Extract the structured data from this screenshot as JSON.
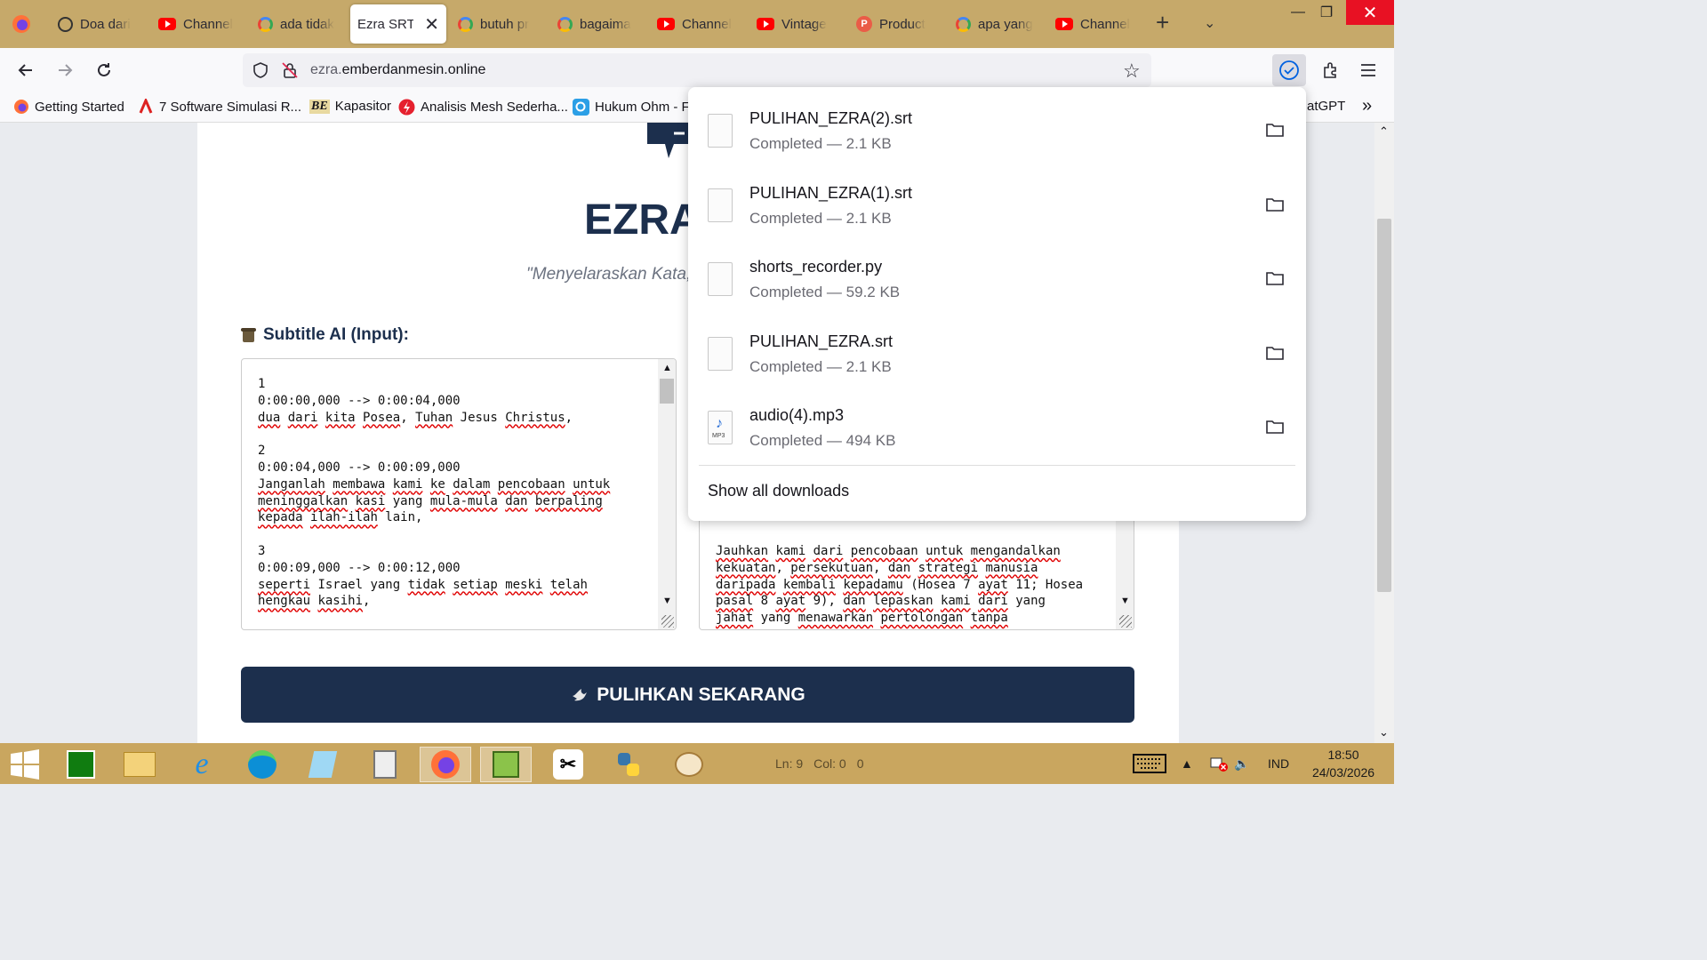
{
  "browser": {
    "tabs": [
      {
        "label": "Doa dari",
        "icon": "chatgpt-icon"
      },
      {
        "label": "Channel",
        "icon": "youtube-icon"
      },
      {
        "label": "ada tidak",
        "icon": "google-icon"
      },
      {
        "label": "Ezra SRT -",
        "icon": "none",
        "active": true
      },
      {
        "label": "butuh pr",
        "icon": "google-icon"
      },
      {
        "label": "bagaima",
        "icon": "google-icon"
      },
      {
        "label": "Channel",
        "icon": "youtube-icon"
      },
      {
        "label": "Vintage",
        "icon": "youtube-icon"
      },
      {
        "label": "Product",
        "icon": "product-hunt-icon"
      },
      {
        "label": "apa yang",
        "icon": "google-icon"
      },
      {
        "label": "Channel",
        "icon": "youtube-icon"
      }
    ],
    "url_host_prefix": "ezra.",
    "url_host_main": "emberdanmesin.online",
    "bookmarks": [
      {
        "label": "Getting Started"
      },
      {
        "label": "7 Software Simulasi R..."
      },
      {
        "label": "Kapasitor"
      },
      {
        "label": "Analisis Mesh Sederha..."
      },
      {
        "label": "Hukum Ohm - F"
      },
      {
        "label": "atGPT"
      }
    ]
  },
  "page": {
    "title": "EZRA",
    "tagline": "\"Menyelaraskan Kata,",
    "input_label": "Subtitle AI (Input):",
    "input_lines": [
      [
        {
          "t": "1"
        }
      ],
      [
        {
          "t": "0:00:00,000 --> 0:00:04,000"
        }
      ],
      [
        {
          "t": "dua",
          "s": 1
        },
        {
          "t": " "
        },
        {
          "t": "dari",
          "s": 1
        },
        {
          "t": " "
        },
        {
          "t": "kita",
          "s": 1
        },
        {
          "t": " "
        },
        {
          "t": "Posea",
          "s": 1
        },
        {
          "t": ", "
        },
        {
          "t": "Tuhan",
          "s": 1
        },
        {
          "t": " Jesus "
        },
        {
          "t": "Christus",
          "s": 1
        },
        {
          "t": ","
        }
      ],
      [
        {
          "t": ""
        }
      ],
      [
        {
          "t": "2"
        }
      ],
      [
        {
          "t": "0:00:04,000 --> 0:00:09,000"
        }
      ],
      [
        {
          "t": "Janganlah",
          "s": 1
        },
        {
          "t": " "
        },
        {
          "t": "membawa",
          "s": 1
        },
        {
          "t": " "
        },
        {
          "t": "kami",
          "s": 1
        },
        {
          "t": " "
        },
        {
          "t": "ke",
          "s": 1
        },
        {
          "t": " "
        },
        {
          "t": "dalam",
          "s": 1
        },
        {
          "t": " "
        },
        {
          "t": "pencobaan",
          "s": 1
        },
        {
          "t": " "
        },
        {
          "t": "untuk",
          "s": 1
        }
      ],
      [
        {
          "t": "meninggalkan",
          "s": 1
        },
        {
          "t": " "
        },
        {
          "t": "kasi",
          "s": 1
        },
        {
          "t": " yang "
        },
        {
          "t": "mula-mula",
          "s": 1
        },
        {
          "t": " "
        },
        {
          "t": "dan",
          "s": 1
        },
        {
          "t": " "
        },
        {
          "t": "berpaling",
          "s": 1
        }
      ],
      [
        {
          "t": "kepada",
          "s": 1
        },
        {
          "t": " "
        },
        {
          "t": "ilah-ilah",
          "s": 1
        },
        {
          "t": " lain,"
        }
      ],
      [
        {
          "t": ""
        }
      ],
      [
        {
          "t": "3"
        }
      ],
      [
        {
          "t": "0:00:09,000 --> 0:00:12,000"
        }
      ],
      [
        {
          "t": "seperti",
          "s": 1
        },
        {
          "t": " Israel yang "
        },
        {
          "t": "tidak",
          "s": 1
        },
        {
          "t": " "
        },
        {
          "t": "setiap",
          "s": 1
        },
        {
          "t": " "
        },
        {
          "t": "meski",
          "s": 1
        },
        {
          "t": " "
        },
        {
          "t": "telah",
          "s": 1
        }
      ],
      [
        {
          "t": "hengkau",
          "s": 1
        },
        {
          "t": " "
        },
        {
          "t": "kasihi",
          "s": 1
        },
        {
          "t": ","
        }
      ]
    ],
    "output_lines": [
      [
        {
          "t": "Jauhkan",
          "s": 1
        },
        {
          "t": " "
        },
        {
          "t": "kami",
          "s": 1
        },
        {
          "t": " "
        },
        {
          "t": "dari",
          "s": 1
        },
        {
          "t": " "
        },
        {
          "t": "pencobaan",
          "s": 1
        },
        {
          "t": " "
        },
        {
          "t": "untuk",
          "s": 1
        },
        {
          "t": " "
        },
        {
          "t": "mengandalkan",
          "s": 1
        }
      ],
      [
        {
          "t": "kekuatan",
          "s": 1
        },
        {
          "t": ", "
        },
        {
          "t": "persekutuan",
          "s": 1
        },
        {
          "t": ", "
        },
        {
          "t": "dan",
          "s": 1
        },
        {
          "t": " "
        },
        {
          "t": "strategi",
          "s": 1
        },
        {
          "t": " "
        },
        {
          "t": "manusia",
          "s": 1
        }
      ],
      [
        {
          "t": "daripada",
          "s": 1
        },
        {
          "t": " "
        },
        {
          "t": "kembali",
          "s": 1
        },
        {
          "t": " "
        },
        {
          "t": "kepadamu",
          "s": 1
        },
        {
          "t": " (Hosea 7 "
        },
        {
          "t": "ayat",
          "s": 1
        },
        {
          "t": " 11; Hosea"
        }
      ],
      [
        {
          "t": "pasal",
          "s": 1
        },
        {
          "t": " 8 "
        },
        {
          "t": "ayat",
          "s": 1
        },
        {
          "t": " 9), "
        },
        {
          "t": "dan",
          "s": 1
        },
        {
          "t": " "
        },
        {
          "t": "lepaskan",
          "s": 1
        },
        {
          "t": " "
        },
        {
          "t": "kami",
          "s": 1
        },
        {
          "t": " "
        },
        {
          "t": "dari",
          "s": 1
        },
        {
          "t": " yang"
        }
      ],
      [
        {
          "t": "jahat",
          "s": 1
        },
        {
          "t": " yang "
        },
        {
          "t": "menawarkan",
          "s": 1
        },
        {
          "t": " "
        },
        {
          "t": "pertolongan",
          "s": 1
        },
        {
          "t": " "
        },
        {
          "t": "tanpa",
          "s": 1
        }
      ]
    ],
    "restore_button": "PULIHKAN SEKARANG"
  },
  "downloads": {
    "items": [
      {
        "name": "PULIHAN_EZRA(2).srt",
        "status": "Completed — 2.1 KB",
        "icon": "file-icon"
      },
      {
        "name": "PULIHAN_EZRA(1).srt",
        "status": "Completed — 2.1 KB",
        "icon": "file-icon"
      },
      {
        "name": "shorts_recorder.py",
        "status": "Completed — 59.2 KB",
        "icon": "file-icon"
      },
      {
        "name": "PULIHAN_EZRA.srt",
        "status": "Completed — 2.1 KB",
        "icon": "file-icon"
      },
      {
        "name": "audio(4).mp3",
        "status": "Completed — 494 KB",
        "icon": "mp3-file-icon",
        "icon_label": "MP3"
      }
    ],
    "show_all": "Show all downloads"
  },
  "taskbar": {
    "editor_status": {
      "line": "Ln: 9",
      "col": "Col: 0",
      "extra": "0"
    },
    "language": "IND",
    "time": "18:50",
    "date": "24/03/2026"
  },
  "colors": {
    "accent": "#1c2f4d",
    "tabbar": "#c6a96a",
    "taskbar": "#c9a65f",
    "download_check": "#0061e0"
  }
}
